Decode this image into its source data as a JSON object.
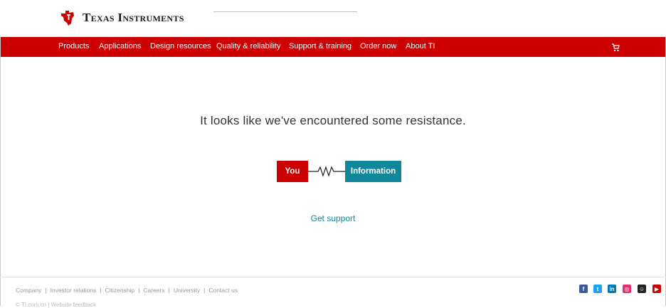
{
  "header": {
    "brand": "Texas Instruments"
  },
  "nav": {
    "items": [
      "Products",
      "Applications",
      "Design resources",
      "Quality & reliability",
      "Support & training",
      "Order now",
      "About TI"
    ]
  },
  "main": {
    "headline": "It looks like we've encountered some resistance.",
    "you_label": "You",
    "information_label": "Information",
    "support_link": "Get support"
  },
  "footer": {
    "links": [
      "Company",
      "Investor relations",
      "Citizenship",
      "Careers",
      "University",
      "Contact us"
    ],
    "social": [
      {
        "name": "facebook-icon",
        "glyph": "f",
        "color": "#3b5998"
      },
      {
        "name": "twitter-icon",
        "glyph": "t",
        "color": "#1da1f2"
      },
      {
        "name": "linkedin-icon",
        "glyph": "in",
        "color": "#0077b5"
      },
      {
        "name": "instagram-icon",
        "glyph": "◎",
        "color": "#e1306c"
      },
      {
        "name": "community-icon",
        "glyph": "☺",
        "color": "#222222"
      },
      {
        "name": "youtube-icon",
        "glyph": "▶",
        "color": "#cc0000"
      }
    ],
    "bottom": "© TI.com.cn | Website feedback"
  },
  "colors": {
    "brand_red": "#cc0000",
    "teal": "#118899"
  }
}
